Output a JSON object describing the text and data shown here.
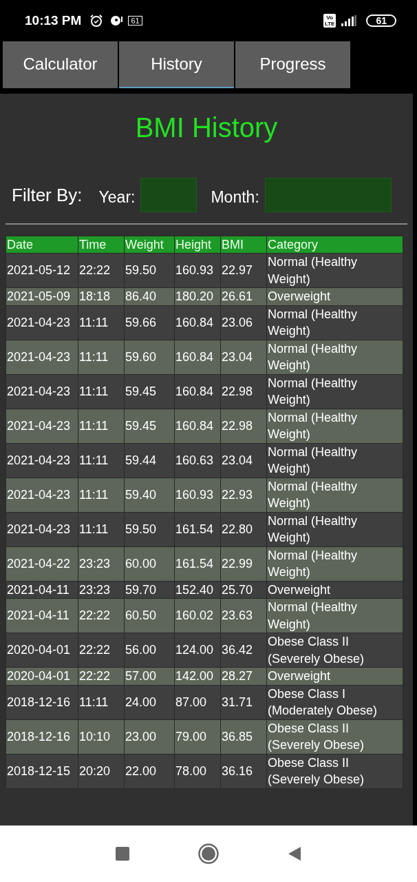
{
  "status_bar": {
    "time": "10:13 PM",
    "small_battery": "61",
    "network_badge": [
      "Vo",
      "LTE"
    ],
    "battery": "61"
  },
  "tabs": [
    {
      "label": "Calculator",
      "selected": false
    },
    {
      "label": "History",
      "selected": true
    },
    {
      "label": "Progress",
      "selected": false
    }
  ],
  "title": "BMI History",
  "filter": {
    "label": "Filter By:",
    "year_label": "Year:",
    "month_label": "Month:"
  },
  "table": {
    "columns": [
      "Date",
      "Time",
      "Weight",
      "Height",
      "BMI",
      "Category"
    ],
    "rows": [
      [
        "2021-05-12",
        "22:22",
        "59.50",
        "160.93",
        "22.97",
        "Normal (Healthy Weight)"
      ],
      [
        "2021-05-09",
        "18:18",
        "86.40",
        "180.20",
        "26.61",
        "Overweight"
      ],
      [
        "2021-04-23",
        "11:11",
        "59.66",
        "160.84",
        "23.06",
        "Normal (Healthy Weight)"
      ],
      [
        "2021-04-23",
        "11:11",
        "59.60",
        "160.84",
        "23.04",
        "Normal (Healthy Weight)"
      ],
      [
        "2021-04-23",
        "11:11",
        "59.45",
        "160.84",
        "22.98",
        "Normal (Healthy Weight)"
      ],
      [
        "2021-04-23",
        "11:11",
        "59.45",
        "160.84",
        "22.98",
        "Normal (Healthy Weight)"
      ],
      [
        "2021-04-23",
        "11:11",
        "59.44",
        "160.63",
        "23.04",
        "Normal (Healthy Weight)"
      ],
      [
        "2021-04-23",
        "11:11",
        "59.40",
        "160.93",
        "22.93",
        "Normal (Healthy Weight)"
      ],
      [
        "2021-04-23",
        "11:11",
        "59.50",
        "161.54",
        "22.80",
        "Normal (Healthy Weight)"
      ],
      [
        "2021-04-22",
        "23:23",
        "60.00",
        "161.54",
        "22.99",
        "Normal (Healthy Weight)"
      ],
      [
        "2021-04-11",
        "23:23",
        "59.70",
        "152.40",
        "25.70",
        "Overweight"
      ],
      [
        "2021-04-11",
        "22:22",
        "60.50",
        "160.02",
        "23.63",
        "Normal (Healthy Weight)"
      ],
      [
        "2020-04-01",
        "22:22",
        "56.00",
        "124.00",
        "36.42",
        "Obese Class II (Severely Obese)"
      ],
      [
        "2020-04-01",
        "22:22",
        "57.00",
        "142.00",
        "28.27",
        "Overweight"
      ],
      [
        "2018-12-16",
        "11:11",
        "24.00",
        "87.00",
        "31.71",
        "Obese Class I (Moderately Obese)"
      ],
      [
        "2018-12-16",
        "10:10",
        "23.00",
        "79.00",
        "36.85",
        "Obese Class II (Severely Obese)"
      ],
      [
        "2018-12-15",
        "20:20",
        "22.00",
        "78.00",
        "36.16",
        "Obese Class II (Severely Obese)"
      ]
    ]
  }
}
